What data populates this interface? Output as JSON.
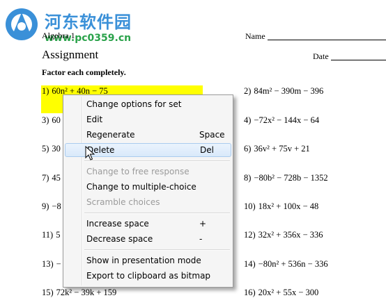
{
  "watermark": {
    "name": "河东软件园",
    "url": "www.pc0359.cn"
  },
  "worksheet": {
    "course": "Algebra 1",
    "title": "Assignment",
    "name_label": "Name",
    "date_label": "Date",
    "instructions": "Factor each completely.",
    "problems_left": [
      {
        "num": "1)",
        "expr": "60n² + 40n − 75"
      },
      {
        "num": "3)",
        "expr": "60"
      },
      {
        "num": "5)",
        "expr": "30"
      },
      {
        "num": "7)",
        "expr": "45"
      },
      {
        "num": "9)",
        "expr": "−8"
      },
      {
        "num": "11)",
        "expr": "5"
      },
      {
        "num": "13)",
        "expr": "−"
      },
      {
        "num": "15)",
        "expr": "72k² − 39k + 159"
      }
    ],
    "problems_right": [
      {
        "num": "2)",
        "expr": "84m² − 390m − 396"
      },
      {
        "num": "4)",
        "expr": "−72x² − 144x − 64"
      },
      {
        "num": "6)",
        "expr": "36v² + 75v + 21"
      },
      {
        "num": "8)",
        "expr": "−80b² − 728b − 1352"
      },
      {
        "num": "10)",
        "expr": "18x² + 100x − 48"
      },
      {
        "num": "12)",
        "expr": "32x² + 356x − 336"
      },
      {
        "num": "14)",
        "expr": "−80n² + 536n − 336"
      },
      {
        "num": "16)",
        "expr": "20x² + 55x − 300"
      }
    ]
  },
  "context_menu": {
    "items": [
      {
        "label": "Change options for set",
        "shortcut": ""
      },
      {
        "label": "Edit",
        "shortcut": ""
      },
      {
        "label": "Regenerate",
        "shortcut": "Space"
      },
      {
        "label": "Delete",
        "shortcut": "Del"
      },
      {
        "label": "Change to free response",
        "shortcut": ""
      },
      {
        "label": "Change to multiple-choice",
        "shortcut": ""
      },
      {
        "label": "Scramble choices",
        "shortcut": ""
      },
      {
        "label": "Increase space",
        "shortcut": "+"
      },
      {
        "label": "Decrease space",
        "shortcut": "-"
      },
      {
        "label": "Show in presentation mode",
        "shortcut": ""
      },
      {
        "label": "Export to clipboard as bitmap",
        "shortcut": ""
      }
    ]
  }
}
